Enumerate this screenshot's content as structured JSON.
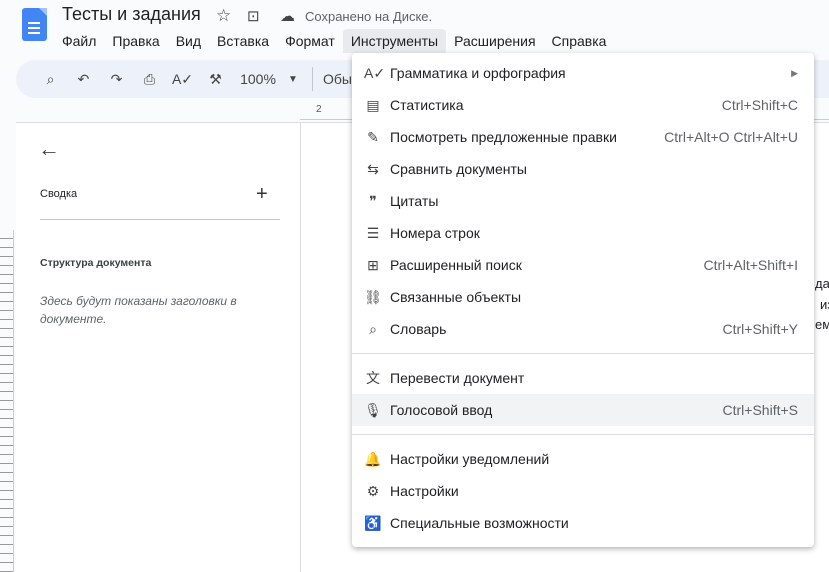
{
  "header": {
    "title": "Тесты и задания",
    "saved": "Сохранено на Диске."
  },
  "menubar": [
    "Файл",
    "Правка",
    "Вид",
    "Вставка",
    "Формат",
    "Инструменты",
    "Расширения",
    "Справка"
  ],
  "toolbar": {
    "zoom": "100%",
    "style": "Обыч"
  },
  "ruler": {
    "mark": "2"
  },
  "sidepanel": {
    "summary": "Сводка",
    "outline": "Структура документа",
    "hint": "Здесь будут показаны заголовки в документе."
  },
  "doc_fragments": [
    "дар",
    "из",
    "ем"
  ],
  "menu": {
    "group1": [
      {
        "label": "Грамматика и орфография",
        "icon": "A✓",
        "submenu": true
      },
      {
        "label": "Статистика",
        "icon": "▤",
        "shortcut": "Ctrl+Shift+C"
      },
      {
        "label": "Посмотреть предложенные правки",
        "icon": "✎",
        "shortcut": "Ctrl+Alt+O Ctrl+Alt+U"
      },
      {
        "label": "Сравнить документы",
        "icon": "⇆"
      },
      {
        "label": "Цитаты",
        "icon": "❞"
      },
      {
        "label": "Номера строк",
        "icon": "☰"
      },
      {
        "label": "Расширенный поиск",
        "icon": "⊞",
        "shortcut": "Ctrl+Alt+Shift+I"
      },
      {
        "label": "Связанные объекты",
        "icon": "⛓"
      },
      {
        "label": "Словарь",
        "icon": "⌕",
        "shortcut": "Ctrl+Shift+Y"
      }
    ],
    "group2": [
      {
        "label": "Перевести документ",
        "icon": "文"
      },
      {
        "label": "Голосовой ввод",
        "icon": "🎙",
        "shortcut": "Ctrl+Shift+S"
      }
    ],
    "group3": [
      {
        "label": "Настройки уведомлений",
        "icon": "🔔"
      },
      {
        "label": "Настройки",
        "icon": "⚙"
      },
      {
        "label": "Специальные возможности",
        "icon": "♿"
      }
    ]
  }
}
